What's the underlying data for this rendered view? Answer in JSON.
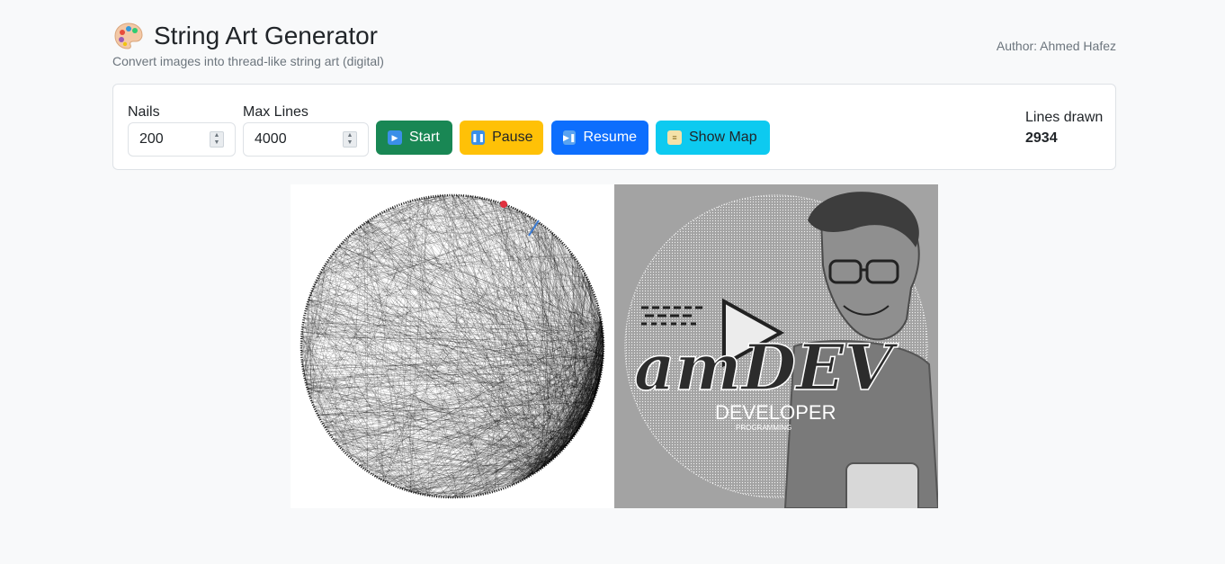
{
  "header": {
    "title": "String Art Generator",
    "subtitle": "Convert images into thread-like string art (digital)",
    "author": "Author: Ahmed Hafez",
    "icon": "palette-icon"
  },
  "controls": {
    "nails_label": "Nails",
    "nails_value": "200",
    "max_lines_label": "Max Lines",
    "max_lines_value": "4000",
    "start_label": "Start",
    "pause_label": "Pause",
    "resume_label": "Resume",
    "show_map_label": "Show Map",
    "lines_drawn_label": "Lines drawn",
    "lines_drawn_value": "2934"
  },
  "colors": {
    "start": "#198754",
    "pause": "#ffc107",
    "resume": "#0d6efd",
    "show_map": "#0dcaf0"
  },
  "preview": {
    "logo_text": "amDEV",
    "developer_text": "DEVELOPER",
    "programming_text": "PROGRAMMING"
  }
}
